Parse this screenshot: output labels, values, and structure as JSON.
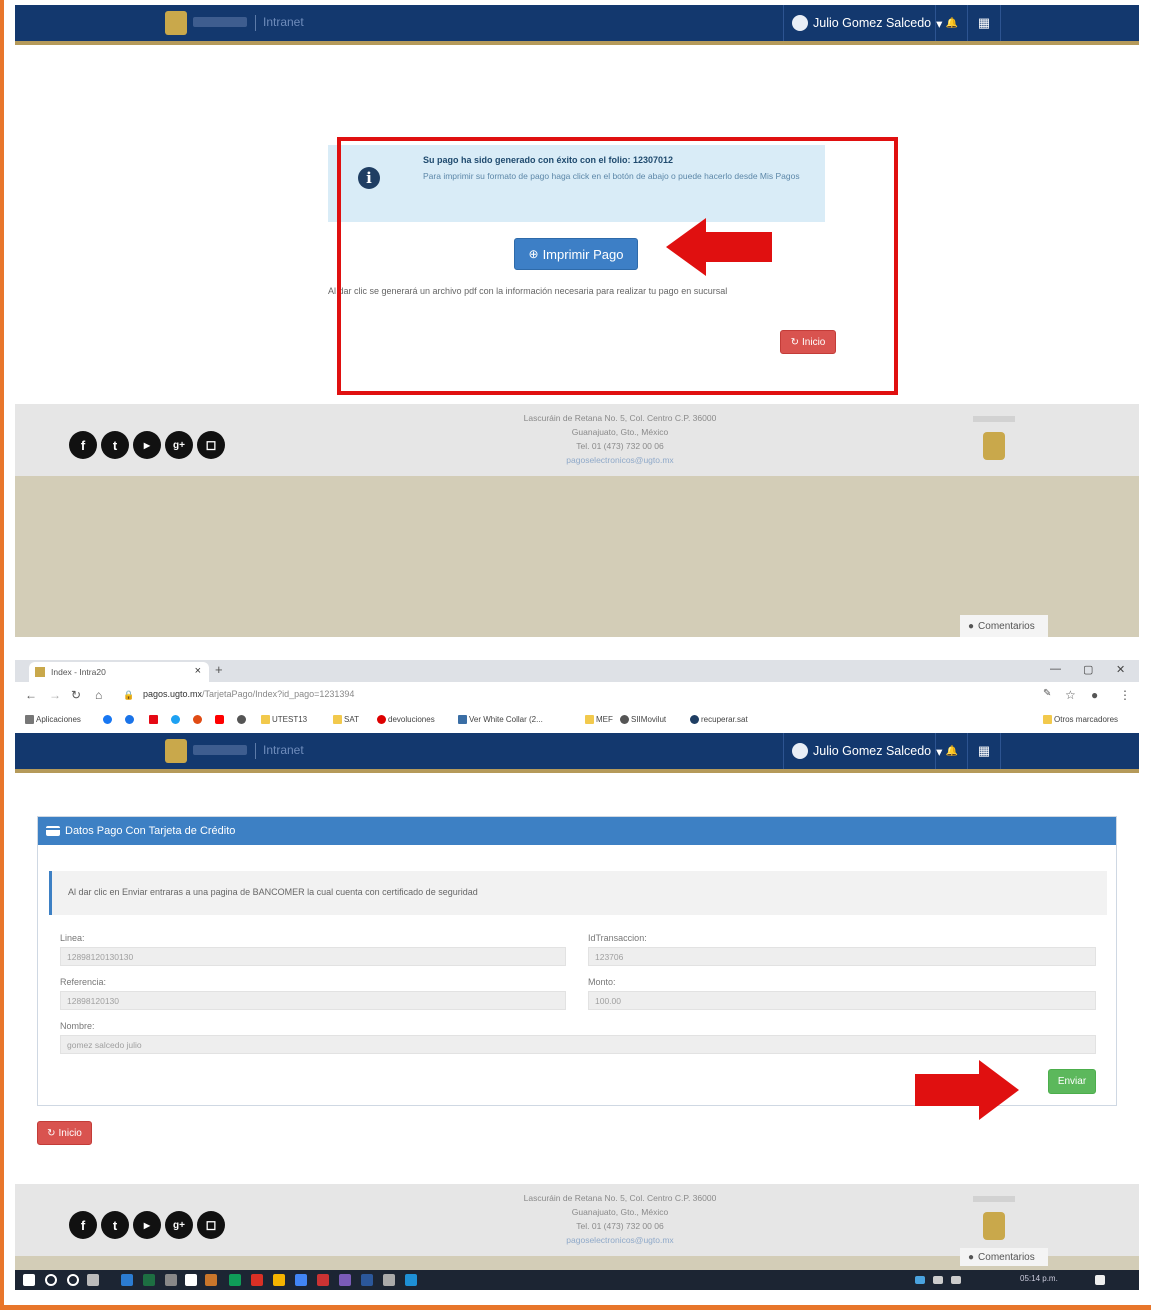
{
  "app": {
    "nav_app_name": "Intranet",
    "user_name": "Julio Gomez Salcedo",
    "user_dropdown_caret": "▾",
    "bell_icon_glyph": "🔔",
    "grid_icon_glyph": "▦"
  },
  "section1": {
    "alert_title": "Su pago ha sido generado con éxito con el folio: 12307012",
    "alert_body": "Para imprimir su formato de pago haga click en el botón de abajo o puede hacerlo desde Mis Pagos",
    "print_button": "Imprimir Pago",
    "info_text": "Al dar clic se generará un archivo pdf con la información necesaria para realizar tu pago en sucursal",
    "home_button": "Inicio"
  },
  "footer": {
    "address_line1": "Lascuráin de Retana No. 5, Col. Centro C.P. 36000",
    "address_line2": "Guanajuato, Gto., México",
    "address_line3": "Tel. 01 (473) 732 00 06",
    "address_email": "pagoselectronicos@ugto.mx",
    "comments_label": "Comentarios"
  },
  "browser": {
    "tab_title": "Index - Intra20",
    "url_domain": "pagos.ugto.mx",
    "url_path": "/TarjetaPago/Index?id_pago=1231394",
    "bookmarks": [
      "Aplicaciones",
      "UTEST13",
      "SAT",
      "devoluciones",
      "Ver White Collar (2...",
      "MEF",
      "SIIMovilut",
      "recuperar.sat"
    ],
    "other_bookmarks": "Otros marcadores"
  },
  "section2": {
    "panel_title": "Datos Pago Con Tarjeta de Crédito",
    "notice": "Al dar clic en Enviar entraras a una pagina de BANCOMER la cual cuenta con certificado de seguridad",
    "fields": {
      "linea_label": "Linea:",
      "linea_value": "12898120130130",
      "transaccion_label": "IdTransaccion:",
      "transaccion_value": "123706",
      "referencia_label": "Referencia:",
      "referencia_value": "12898120130",
      "monto_label": "Monto:",
      "monto_value": "100.00",
      "nombre_label": "Nombre:",
      "nombre_value": "gomez salcedo julio"
    },
    "send_button": "Enviar",
    "home_button": "Inicio"
  },
  "taskbar": {
    "time": "05:14 p.m."
  },
  "colors": {
    "navbar": "#13386e",
    "gold": "#b59a5a",
    "primary": "#3d80c4",
    "danger": "#d9534f",
    "success": "#5cb85c",
    "highlight": "#e01010",
    "frame": "#e8762b"
  }
}
